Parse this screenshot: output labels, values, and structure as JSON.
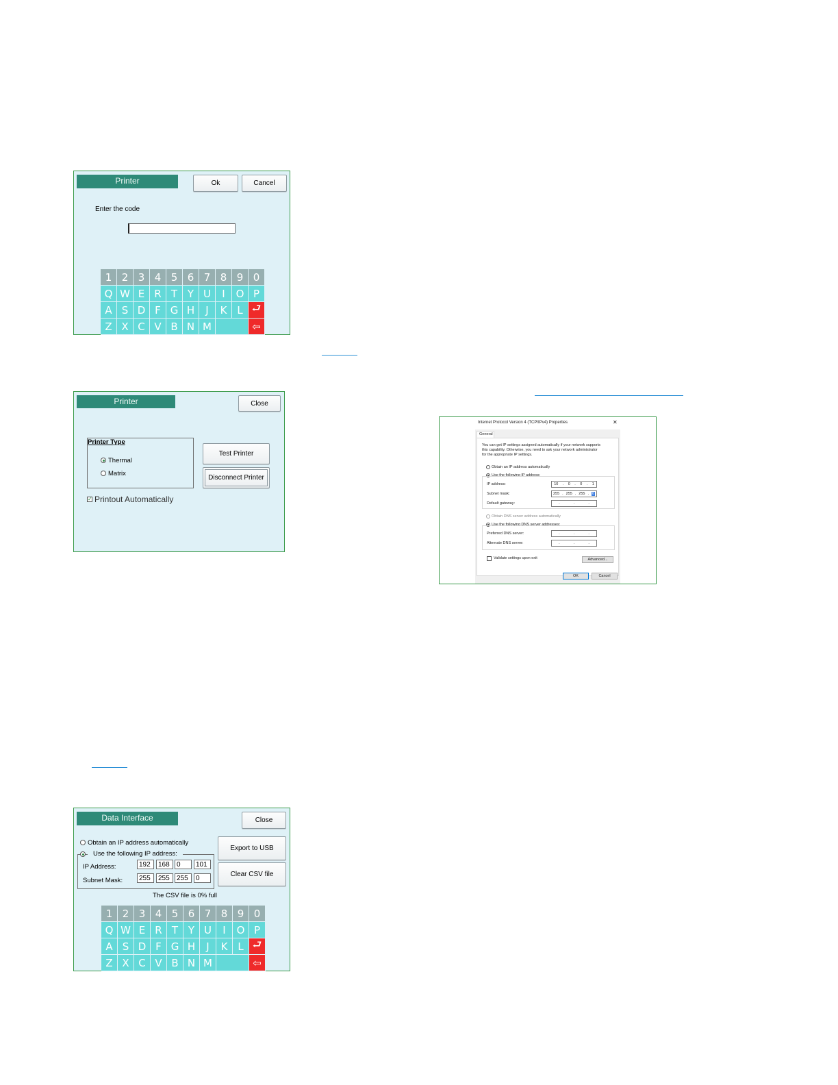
{
  "keyboard": {
    "rows": [
      [
        "1",
        "2",
        "3",
        "4",
        "5",
        "6",
        "7",
        "8",
        "9",
        "0"
      ],
      [
        "Q",
        "W",
        "E",
        "R",
        "T",
        "Y",
        "U",
        "I",
        "O",
        "P"
      ],
      [
        "A",
        "S",
        "D",
        "F",
        "G",
        "H",
        "J",
        "K",
        "L"
      ],
      [
        "Z",
        "X",
        "C",
        "V",
        "B",
        "N",
        "M"
      ]
    ],
    "enter_glyph": "⮐",
    "backspace_glyph": "⇦"
  },
  "printer_code": {
    "title": "Printer",
    "ok_label": "Ok",
    "cancel_label": "Cancel",
    "prompt": "Enter the code",
    "code_value": ""
  },
  "printer_settings": {
    "title": "Printer",
    "close_label": "Close",
    "printer_type_label": "Printer Type",
    "options": [
      "Thermal",
      "Matrix"
    ],
    "selected_option": "Thermal",
    "test_label": "Test Printer",
    "disconnect_label": "Disconnect Printer",
    "printout_label": "Printout Automatically",
    "printout_checked": true
  },
  "tcpip_dialog": {
    "title": "Internet Protocol Version 4 (TCP/IPv4) Properties",
    "close_glyph": "✕",
    "tab": "General",
    "description": [
      "You can get IP settings assigned automatically if your network supports",
      "this capability. Otherwise, you need to ask your network administrator",
      "for the appropriate IP settings."
    ],
    "obtain_auto": "Obtain an IP address automatically",
    "use_following": "Use the following IP address:",
    "ip_label": "IP address:",
    "ip_value": [
      "10",
      "0",
      "0",
      "1"
    ],
    "subnet_label": "Subnet mask:",
    "subnet_value": [
      "255",
      "255",
      "255",
      "0"
    ],
    "gateway_label": "Default gateway:",
    "obtain_dns_auto": "Obtain DNS server address automatically",
    "use_dns": "Use the following DNS server addresses:",
    "preferred_dns": "Preferred DNS server:",
    "alternate_dns": "Alternate DNS server:",
    "validate": "Validate settings upon exit",
    "advanced": "Advanced...",
    "ok": "OK",
    "cancel": "Cancel"
  },
  "data_interface": {
    "title": "Data Interface",
    "close_label": "Close",
    "obtain_auto": "Obtain an IP address automatically",
    "use_following": "Use the following IP address:",
    "ip_label": "IP Address:",
    "ip_octets": [
      "192",
      "168",
      "0",
      "101"
    ],
    "subnet_label": "Subnet Mask:",
    "subnet_octets": [
      "255",
      "255",
      "255",
      "0"
    ],
    "export_label": "Export to USB",
    "clear_label": "Clear CSV file",
    "csv_status": "The CSV file is 0% full"
  },
  "colors": {
    "panel_bg": "#dff1f7",
    "title_bg": "#2e8a78",
    "key_number": "#97afb0",
    "key_letter": "#63d9d8",
    "key_action": "#ef2a2a",
    "link": "#2a8fd6"
  }
}
